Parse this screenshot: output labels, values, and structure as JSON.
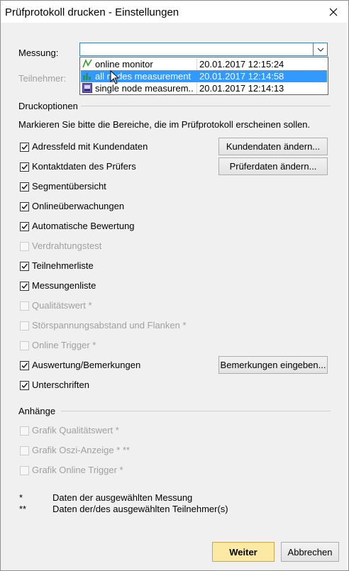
{
  "window": {
    "title": "Prüfprotokoll drucken - Einstellungen"
  },
  "messung": {
    "label": "Messung:",
    "dropdown": [
      {
        "name": "online monitor",
        "datetime": "20.01.2017  12:15:24",
        "icon": "online-monitor-icon"
      },
      {
        "name": "all nodes measurement",
        "datetime": "20.01.2017  12:14:58",
        "icon": "bar-chart-icon",
        "selected": true
      },
      {
        "name": "single node measurem...",
        "datetime": "20.01.2017  12:14:13",
        "icon": "single-node-icon"
      }
    ]
  },
  "teilnehmer": {
    "label": "Teilnehmer:"
  },
  "druckoptionen": {
    "header": "Druckoptionen",
    "instruction": "Markieren Sie bitte die Bereiche, die im Prüfprotokoll erscheinen sollen.",
    "items": [
      {
        "label": "Adressfeld mit Kundendaten",
        "checked": true,
        "enabled": true
      },
      {
        "label": "Kontaktdaten des Prüfers",
        "checked": true,
        "enabled": true
      },
      {
        "label": "Segmentübersicht",
        "checked": true,
        "enabled": true
      },
      {
        "label": "Onlineüberwachungen",
        "checked": true,
        "enabled": true
      },
      {
        "label": "Automatische Bewertung",
        "checked": true,
        "enabled": true
      },
      {
        "label": "Verdrahtungstest",
        "checked": false,
        "enabled": false
      },
      {
        "label": "Teilnehmerliste",
        "checked": true,
        "enabled": true
      },
      {
        "label": "Messungenliste",
        "checked": true,
        "enabled": true
      },
      {
        "label": "Qualitätswert *",
        "checked": false,
        "enabled": false
      },
      {
        "label": "Störspannungsabstand und Flanken *",
        "checked": false,
        "enabled": false
      },
      {
        "label": "Online Trigger *",
        "checked": false,
        "enabled": false
      },
      {
        "label": "Auswertung/Bemerkungen",
        "checked": true,
        "enabled": true
      },
      {
        "label": "Unterschriften",
        "checked": true,
        "enabled": true
      }
    ],
    "buttons": {
      "kundendaten": "Kundendaten ändern...",
      "pruferdaten": "Prüferdaten ändern...",
      "bemerkungen": "Bemerkungen eingeben..."
    }
  },
  "anhaenge": {
    "header": "Anhänge",
    "items": [
      {
        "label": "Grafik Qualitätswert *",
        "checked": false,
        "enabled": false
      },
      {
        "label": "Grafik Oszi-Anzeige * **",
        "checked": false,
        "enabled": false
      },
      {
        "label": "Grafik Online Trigger *",
        "checked": false,
        "enabled": false
      }
    ]
  },
  "footnotes": [
    {
      "key": "*",
      "text": "Daten der ausgewählten Messung"
    },
    {
      "key": "**",
      "text": "Daten der/des ausgewählten Teilnehmer(s)"
    }
  ],
  "footer": {
    "weiter": "Weiter",
    "abbrechen": "Abbrechen"
  }
}
